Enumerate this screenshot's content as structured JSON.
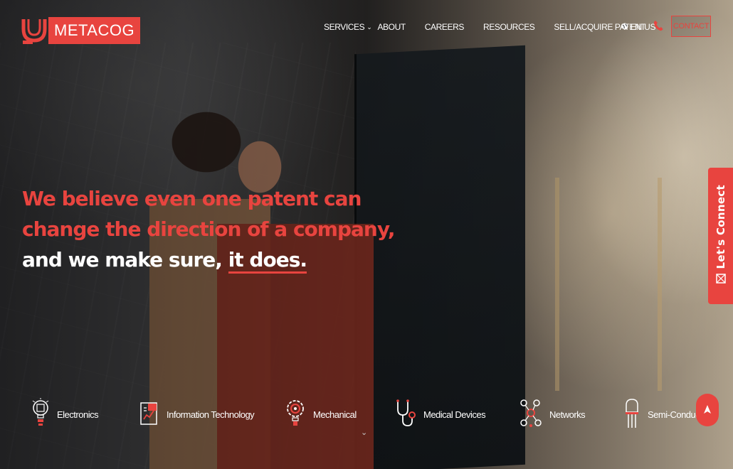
{
  "brand": {
    "name": "METACOG"
  },
  "nav": {
    "items": [
      {
        "label": "SERVICES",
        "has_dropdown": true
      },
      {
        "label": "ABOUT"
      },
      {
        "label": "CAREERS"
      },
      {
        "label": "RESOURCES"
      },
      {
        "label": "SELL/ACQUIRE PATENT"
      }
    ],
    "language": "EN US",
    "contact_label": "CONTACT"
  },
  "hero": {
    "line1": "We believe even one patent can",
    "line2": "change the direction of a company,",
    "line3_prefix": "and we make sure, ",
    "line3_emphasis": "it does."
  },
  "side_tab": {
    "label": "Let's Connect"
  },
  "categories": [
    {
      "label": "Electronics",
      "icon": "lightbulb-chip-icon"
    },
    {
      "label": "Information Technology",
      "icon": "document-chart-icon"
    },
    {
      "label": "Mechanical",
      "icon": "gear-bulb-icon"
    },
    {
      "label": "Medical Devices",
      "icon": "stethoscope-icon"
    },
    {
      "label": "Networks",
      "icon": "network-nodes-icon"
    },
    {
      "label": "Semi-Conduc",
      "icon": "semiconductor-icon"
    }
  ],
  "colors": {
    "accent": "#e8443f",
    "text": "#ffffff"
  }
}
